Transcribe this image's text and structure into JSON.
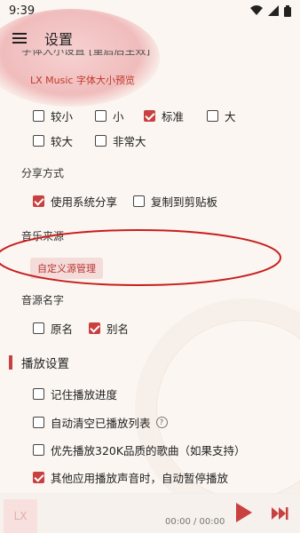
{
  "status": {
    "time": "9:39"
  },
  "appbar": {
    "title": "设置"
  },
  "partial": {
    "cut_text": "字体大小设置 [重启后生效]"
  },
  "font_size": {
    "preview": "LX Music 字体大小预览",
    "options": [
      {
        "label": "较小",
        "checked": false
      },
      {
        "label": "小",
        "checked": false
      },
      {
        "label": "标准",
        "checked": true
      },
      {
        "label": "大",
        "checked": false
      },
      {
        "label": "较大",
        "checked": false
      },
      {
        "label": "非常大",
        "checked": false
      }
    ]
  },
  "share": {
    "title": "分享方式",
    "options": [
      {
        "label": "使用系统分享",
        "checked": true
      },
      {
        "label": "复制到剪贴板",
        "checked": false
      }
    ]
  },
  "source": {
    "title": "音乐来源",
    "button": "自定义源管理"
  },
  "source_name": {
    "title": "音源名字",
    "options": [
      {
        "label": "原名",
        "checked": false
      },
      {
        "label": "别名",
        "checked": true
      }
    ]
  },
  "playback": {
    "title": "播放设置",
    "options": [
      {
        "label": "记住播放进度",
        "checked": false
      },
      {
        "label": "自动清空已播放列表",
        "checked": false
      },
      {
        "label": "优先播放320K品质的歌曲（如果支持）",
        "checked": false
      },
      {
        "label": "其他应用播放声音时，自动暂停播放",
        "checked": true
      }
    ],
    "help_icon": "?"
  },
  "player": {
    "logo": "LX",
    "time": "00:00 / 00:00"
  }
}
